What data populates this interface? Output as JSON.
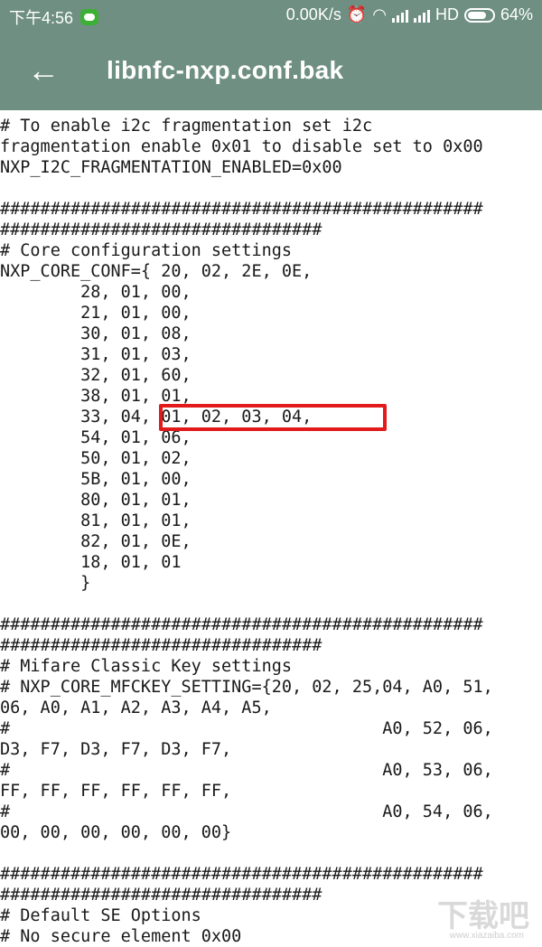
{
  "status_bar": {
    "time": "下午4:56",
    "speed": "0.00K/s",
    "hd": "HD",
    "battery": "64%"
  },
  "app_bar": {
    "back_icon": "arrow-left-icon",
    "title": "libnfc-nxp.conf.bak"
  },
  "file_lines": [
    "# To enable i2c fragmentation set i2c",
    "fragmentation enable 0x01 to disable set to 0x00",
    "NXP_I2C_FRAGMENTATION_ENABLED=0x00",
    "",
    "################################################",
    "################################",
    "# Core configuration settings",
    "NXP_CORE_CONF={ 20, 02, 2E, 0E,",
    "        28, 01, 00,",
    "        21, 01, 00,",
    "        30, 01, 08,",
    "        31, 01, 03,",
    "        32, 01, 60,",
    "        38, 01, 01,",
    "        33, 04, 01, 02, 03, 04,",
    "        54, 01, 06,",
    "        50, 01, 02,",
    "        5B, 01, 00,",
    "        80, 01, 01,",
    "        81, 01, 01,",
    "        82, 01, 0E,",
    "        18, 01, 01",
    "        }",
    "",
    "################################################",
    "################################",
    "# Mifare Classic Key settings",
    "# NXP_CORE_MFCKEY_SETTING={20, 02, 25,04, A0, 51,",
    "06, A0, A1, A2, A3, A4, A5,",
    "#                                     A0, 52, 06,",
    "D3, F7, D3, F7, D3, F7,",
    "#                                     A0, 53, 06,",
    "FF, FF, FF, FF, FF, FF,",
    "#                                     A0, 54, 06,",
    "00, 00, 00, 00, 00, 00}",
    "",
    "################################################",
    "################################",
    "# Default SE Options",
    "# No secure element 0x00"
  ],
  "highlight_color": "#e21a1a",
  "watermark": "下载吧",
  "watermark_url": "www.xiazaiba.com"
}
